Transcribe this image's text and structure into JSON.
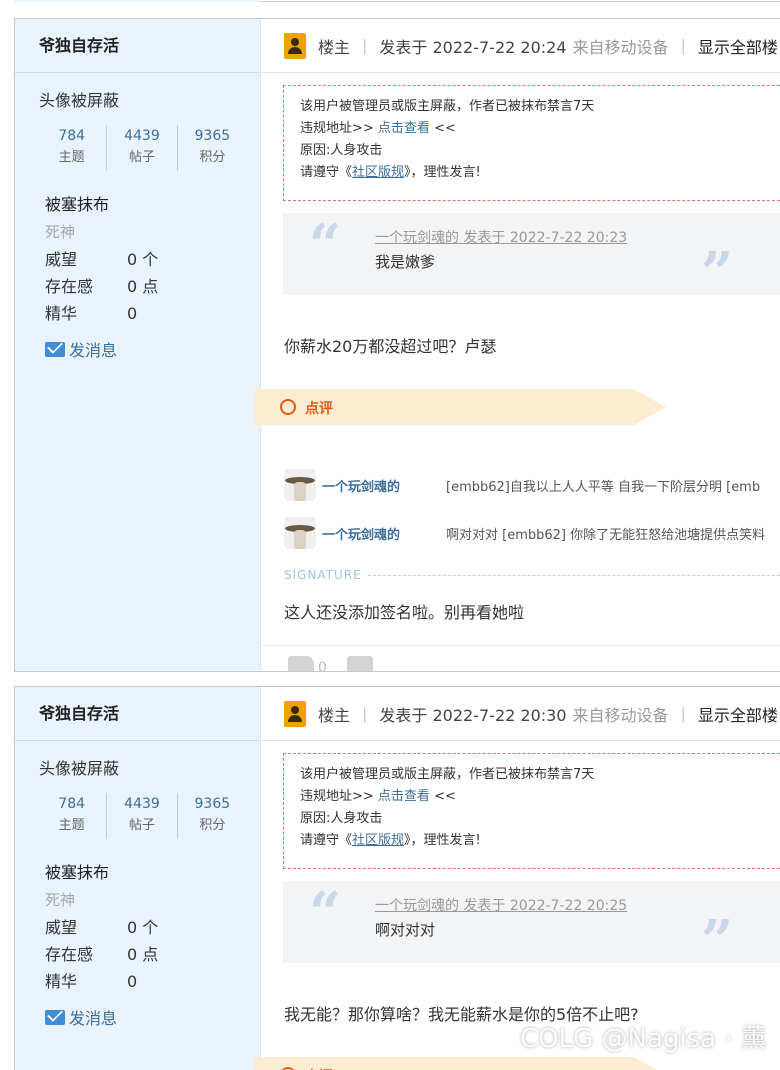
{
  "watermark": "COLG @Nagisa · 薰",
  "posts": [
    {
      "author": "爷独自存活",
      "avatar_blocked": "头像被屏蔽",
      "stats": [
        {
          "value": "784",
          "label": "主题"
        },
        {
          "value": "4439",
          "label": "帖子"
        },
        {
          "value": "9365",
          "label": "积分"
        }
      ],
      "group": "被塞抹布",
      "title": "死神",
      "fields": [
        {
          "k": "威望",
          "v": "0 个"
        },
        {
          "k": "存在感",
          "v": "0 点"
        },
        {
          "k": "精华",
          "v": "0"
        }
      ],
      "send_msg": "发消息",
      "floor": "楼主",
      "posted": "发表于 2022-7-22 20:24",
      "device": "来自移动设备",
      "show_all": "显示全部楼",
      "notice": {
        "line1": "该用户被管理员或版主屏蔽，作者已被抹布禁言7天",
        "line2_prefix": "违规地址>> ",
        "line2_link": "点击查看",
        "line2_suffix": " <<",
        "line3": "原因:人身攻击",
        "line4_prefix": "请遵守《",
        "line4_link": "社区版规",
        "line4_suffix": "》，理性发言!"
      },
      "quote_open": "“",
      "quote_close": "”",
      "quote_meta": "一个玩剑魂的 发表于 2022-7-22 20:23",
      "quote_text": "我是嫩爹",
      "body": "你薪水20万都没超过吧？卢瑟",
      "rate_label": "点评",
      "comments": [
        {
          "name": "一个玩剑魂的",
          "text": "[embb62]自我以上人人平等 自我一下阶层分明 [emb"
        },
        {
          "name": "一个玩剑魂的",
          "text": "啊对对对 [embb62] 你除了无能狂怒给池塘提供点笑料"
        }
      ],
      "signature_label": "SIGNATURE",
      "signature_text": "这人还没添加签名啦。别再看她啦",
      "likes": "0"
    },
    {
      "author": "爷独自存活",
      "avatar_blocked": "头像被屏蔽",
      "stats": [
        {
          "value": "784",
          "label": "主题"
        },
        {
          "value": "4439",
          "label": "帖子"
        },
        {
          "value": "9365",
          "label": "积分"
        }
      ],
      "group": "被塞抹布",
      "title": "死神",
      "fields": [
        {
          "k": "威望",
          "v": "0 个"
        },
        {
          "k": "存在感",
          "v": "0 点"
        },
        {
          "k": "精华",
          "v": "0"
        }
      ],
      "send_msg": "发消息",
      "floor": "楼主",
      "posted": "发表于 2022-7-22 20:30",
      "device": "来自移动设备",
      "show_all": "显示全部楼",
      "notice": {
        "line1": "该用户被管理员或版主屏蔽，作者已被抹布禁言7天",
        "line2_prefix": "违规地址>> ",
        "line2_link": "点击查看",
        "line2_suffix": " <<",
        "line3": "原因:人身攻击",
        "line4_prefix": "请遵守《",
        "line4_link": "社区版规",
        "line4_suffix": "》，理性发言!"
      },
      "quote_open": "“",
      "quote_close": "”",
      "quote_meta": "一个玩剑魂的 发表于 2022-7-22 20:25",
      "quote_text": "啊对对对",
      "body": "我无能？那你算啥？我无能薪水是你的5倍不止吧?",
      "rate_label": "点评"
    }
  ]
}
